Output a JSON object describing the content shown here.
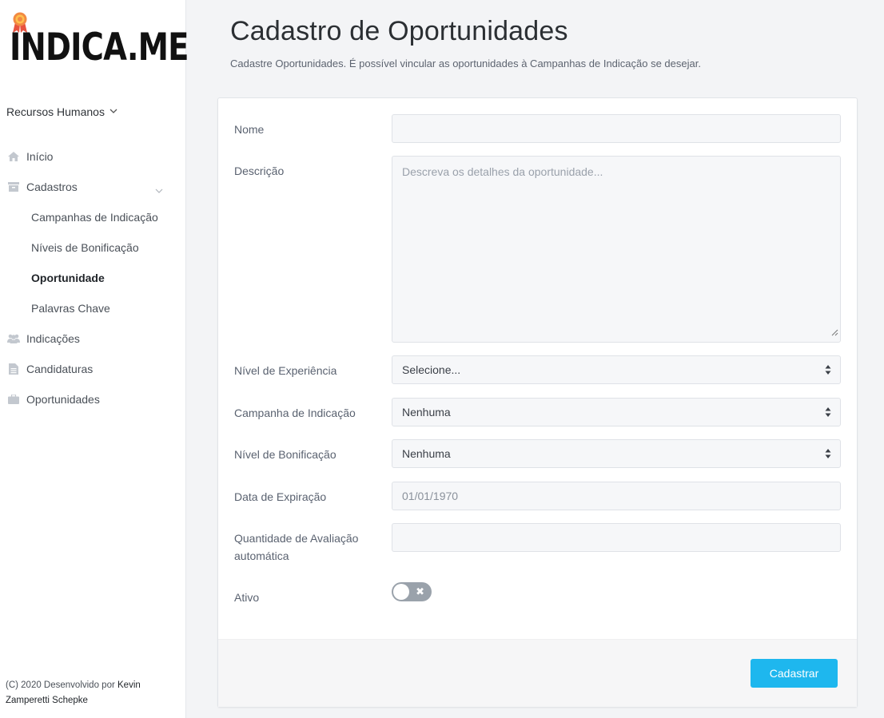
{
  "brand": {
    "logo_text": "INDICA.ME",
    "accent": "#1eb7ee"
  },
  "sidebar": {
    "role": "Recursos Humanos",
    "items": [
      {
        "label": "Início",
        "icon": "home-icon"
      },
      {
        "label": "Cadastros",
        "icon": "archive-icon",
        "expanded": true,
        "children": [
          {
            "label": "Campanhas de Indicação"
          },
          {
            "label": "Níveis de Bonificação"
          },
          {
            "label": "Oportunidade",
            "active": true
          },
          {
            "label": "Palavras Chave"
          }
        ]
      },
      {
        "label": "Indicações",
        "icon": "users-icon"
      },
      {
        "label": "Candidaturas",
        "icon": "file-icon"
      },
      {
        "label": "Oportunidades",
        "icon": "briefcase-icon"
      }
    ],
    "footer_prefix": "(C) 2020 Desenvolvido por",
    "footer_author": "Kevin Zamperetti Schepke"
  },
  "page": {
    "title": "Cadastro de Oportunidades",
    "subtitle": "Cadastre Oportunidades. É possível vincular as oportunidades à Campanhas de Indicação se desejar."
  },
  "form": {
    "nome": {
      "label": "Nome",
      "value": ""
    },
    "descricao": {
      "label": "Descrição",
      "placeholder": "Descreva os detalhes da oportunidade..."
    },
    "nivel_experiencia": {
      "label": "Nível de Experiência",
      "selected": "Selecione..."
    },
    "campanha": {
      "label": "Campanha de Indicação",
      "selected": "Nenhuma"
    },
    "nivel_bonificacao": {
      "label": "Nível de Bonificação",
      "selected": "Nenhuma"
    },
    "data_expiracao": {
      "label": "Data de Expiração",
      "value": "01/01/1970"
    },
    "quantidade": {
      "label": "Quantidade de Avaliação automática",
      "value": ""
    },
    "ativo": {
      "label": "Ativo",
      "on": false
    },
    "submit_label": "Cadastrar"
  }
}
